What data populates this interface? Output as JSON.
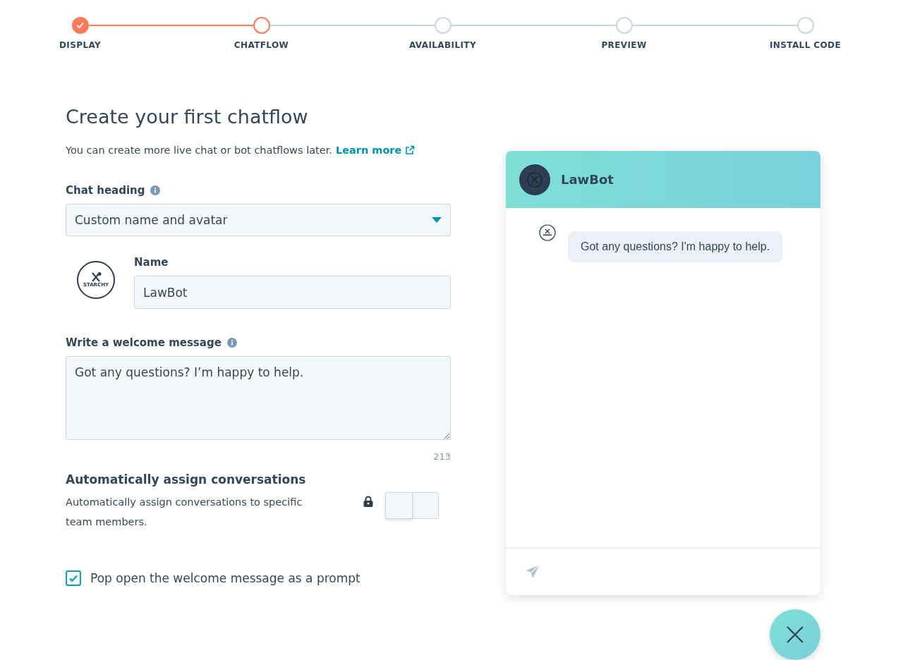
{
  "steps": [
    {
      "label": "DISPLAY",
      "completed": true,
      "selected": false
    },
    {
      "label": "CHATFLOW",
      "completed": false,
      "selected": true
    },
    {
      "label": "AVAILABILITY",
      "completed": false,
      "selected": false
    },
    {
      "label": "PREVIEW",
      "completed": false,
      "selected": false
    },
    {
      "label": "INSTALL CODE",
      "completed": false,
      "selected": false
    }
  ],
  "title": "Create your first chatflow",
  "intro": {
    "text": "You can create more live chat or bot chatflows later.",
    "link": "Learn more"
  },
  "chat_heading": {
    "label": "Chat heading",
    "value": "Custom name and avatar"
  },
  "avatar": {
    "logo_text": "STARCHY"
  },
  "name_field": {
    "label": "Name",
    "value": "LawBot"
  },
  "welcome": {
    "label": "Write a welcome message",
    "value": "Got any questions? I’m happy to help.",
    "counter": "213"
  },
  "assign": {
    "title": "Automatically assign conversations",
    "description": "Automatically assign conversations to specific team members.",
    "locked": true,
    "on": false
  },
  "prompt_checkbox": {
    "label": "Pop open the welcome message as a prompt",
    "checked": true
  },
  "preview": {
    "bot_name": "LawBot",
    "message": "Got any questions? I'm happy to help."
  }
}
